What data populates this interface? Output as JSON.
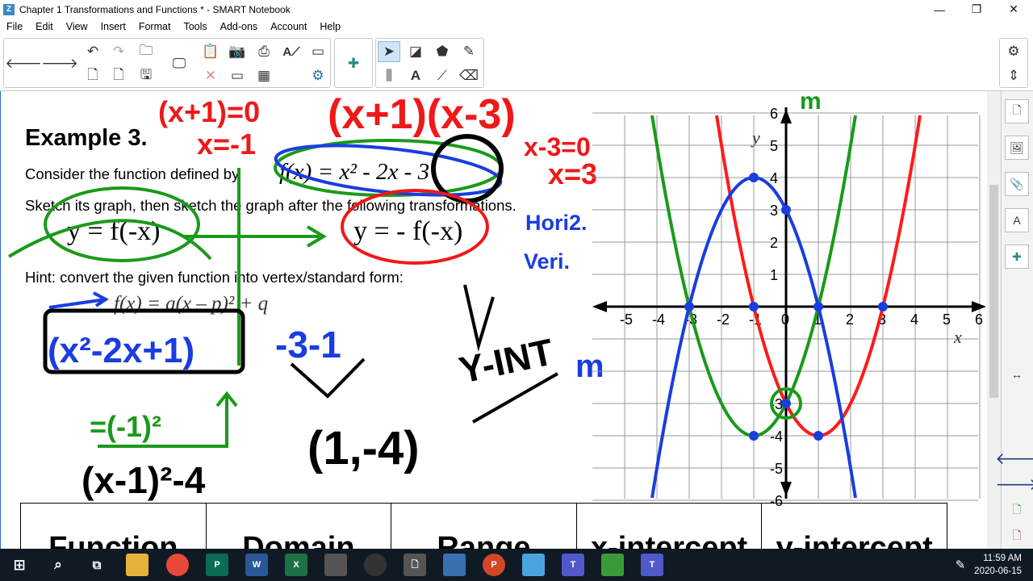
{
  "window": {
    "title": "Chapter 1 Transformations and Functions * - SMART Notebook",
    "app_icon": "Z"
  },
  "window_controls": {
    "minimize": "—",
    "maximize": "❐",
    "close": "✕"
  },
  "menu": [
    "File",
    "Edit",
    "View",
    "Insert",
    "Format",
    "Tools",
    "Add-ons",
    "Account",
    "Help"
  ],
  "page": {
    "example_title": "Example 3",
    "example_dot": ".",
    "line1": "Consider the function defined by",
    "func": "f(x) = x² - 2x - 3",
    "line2": "Sketch its graph, then sketch the graph after the following transformations.",
    "t1": "y = f(-x)",
    "t2": "y = - f(-x)",
    "hint": "Hint:  convert the given function into vertex/standard form:",
    "vertex_form": "f(x) = a(x – p)² + q",
    "table_headers": [
      "Function",
      "Domain",
      "Range",
      "x-intercept",
      "y-intercept"
    ]
  },
  "ink": {
    "factor_eq": "(x+1)=0",
    "factor_sol": "x=-1",
    "factored": "(x+1)(x-3)",
    "root2_eq": "x-3=0",
    "root2_sol": "x=3",
    "horiz": "Hori2.",
    "vert": "Veri.",
    "completing": "(x²-2x+1)",
    "minus": "-3-1",
    "half": "=(-1)²",
    "vertex_form_result": "(x-1)²-4",
    "vertex": "(1,-4)",
    "yint": "Y-INT",
    "m_top": "m",
    "m_side": "m"
  },
  "graph": {
    "x_ticks": [
      "-5",
      "-4",
      "-3",
      "-2",
      "-1",
      "0",
      "1",
      "2",
      "3",
      "4",
      "5",
      "6"
    ],
    "y_ticks": [
      "6",
      "5",
      "4",
      "3",
      "2",
      "1",
      "-3",
      "-4",
      "-5",
      "-6"
    ],
    "x_label": "x",
    "y_label": "y",
    "colors": {
      "original": "#ff1a1a",
      "reflect_y": "#1a9a1a",
      "reflect_both": "#1a3de0"
    }
  },
  "taskbar": {
    "time": "11:59 AM",
    "date": "2020-06-15"
  }
}
